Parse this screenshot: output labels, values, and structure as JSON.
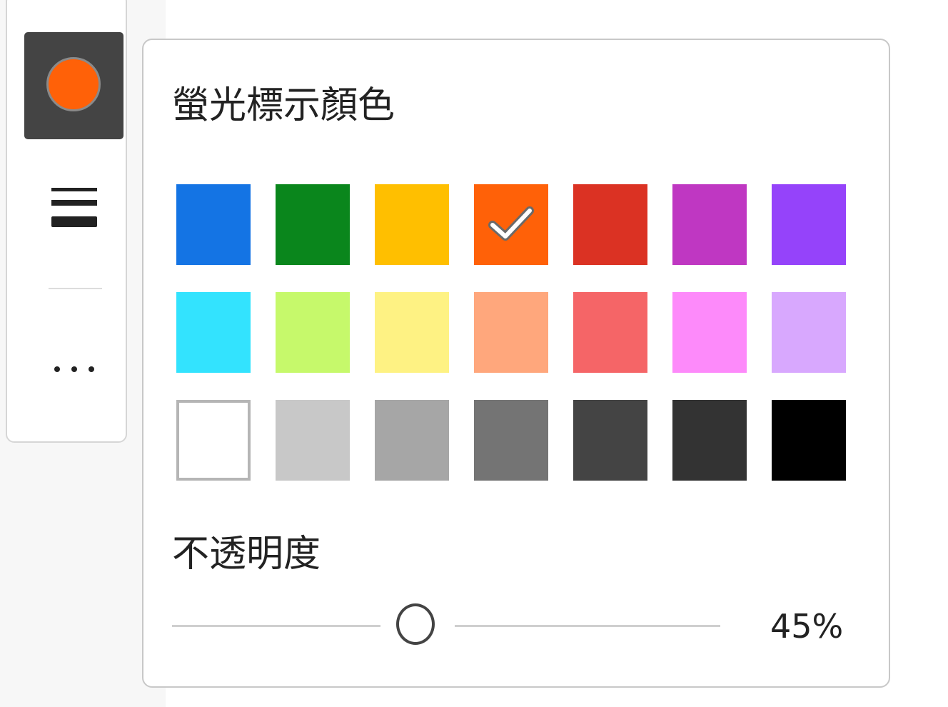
{
  "toolbar": {
    "current_color": "#ff6108",
    "color_tool_icon": "color-circle-icon",
    "thickness_icon": "line-thickness-icon",
    "more_icon": "ellipsis-icon"
  },
  "highlight_panel": {
    "title": "螢光標示顏色",
    "selected_color": "#ff6108",
    "colors": [
      [
        "#1474e4",
        "#0a861c",
        "#ffbf00",
        "#ff6108",
        "#db3223",
        "#bf37c2",
        "#9543fa"
      ],
      [
        "#33e3fe",
        "#c6f96b",
        "#fef283",
        "#ffa77c",
        "#f56567",
        "#fd8afa",
        "#d8a8fe"
      ],
      [
        "#ffffff",
        "#c8c8c8",
        "#a6a6a6",
        "#747474",
        "#444444",
        "#333333",
        "#000000"
      ]
    ],
    "opacity_label": "不透明度",
    "opacity_value": 45,
    "opacity_text": "45%"
  }
}
